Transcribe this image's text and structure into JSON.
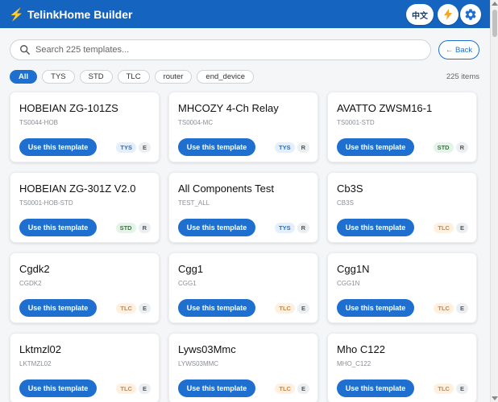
{
  "header": {
    "title": "TelinkHome Builder",
    "lang_label": "中文"
  },
  "search": {
    "placeholder": "Search 225 templates...",
    "back_label": "← Back"
  },
  "filters": [
    "All",
    "TYS",
    "STD",
    "TLC",
    "router",
    "end_device"
  ],
  "count_label": "225 items",
  "use_label": "Use this template",
  "colors": {
    "primary": "#1e6fd0",
    "header": "#1565c0",
    "accent": "#ffc107"
  },
  "cards": [
    {
      "name": "HOBEIAN ZG-101ZS",
      "code": "TS0044-HOB",
      "tag": "TYS",
      "letter": "E"
    },
    {
      "name": "MHCOZY 4-Ch Relay",
      "code": "TS0004-MC",
      "tag": "TYS",
      "letter": "R"
    },
    {
      "name": "AVATTO ZWSM16-1",
      "code": "TS0001-STD",
      "tag": "STD",
      "letter": "R"
    },
    {
      "name": "HOBEIAN ZG-301Z V2.0",
      "code": "TS0001-HOB-STD",
      "tag": "STD",
      "letter": "R"
    },
    {
      "name": "All Components Test",
      "code": "TEST_ALL",
      "tag": "TYS",
      "letter": "R"
    },
    {
      "name": "Cb3S",
      "code": "CB3S",
      "tag": "TLC",
      "letter": "E"
    },
    {
      "name": "Cgdk2",
      "code": "CGDK2",
      "tag": "TLC",
      "letter": "E"
    },
    {
      "name": "Cgg1",
      "code": "CGG1",
      "tag": "TLC",
      "letter": "E"
    },
    {
      "name": "Cgg1N",
      "code": "CGG1N",
      "tag": "TLC",
      "letter": "E"
    },
    {
      "name": "Lktmzl02",
      "code": "LKTMZL02",
      "tag": "TLC",
      "letter": "E"
    },
    {
      "name": "Lyws03Mmc",
      "code": "LYWS03MMC",
      "tag": "TLC",
      "letter": "E"
    },
    {
      "name": "Mho C122",
      "code": "MHO_C122",
      "tag": "TLC",
      "letter": "E"
    }
  ]
}
